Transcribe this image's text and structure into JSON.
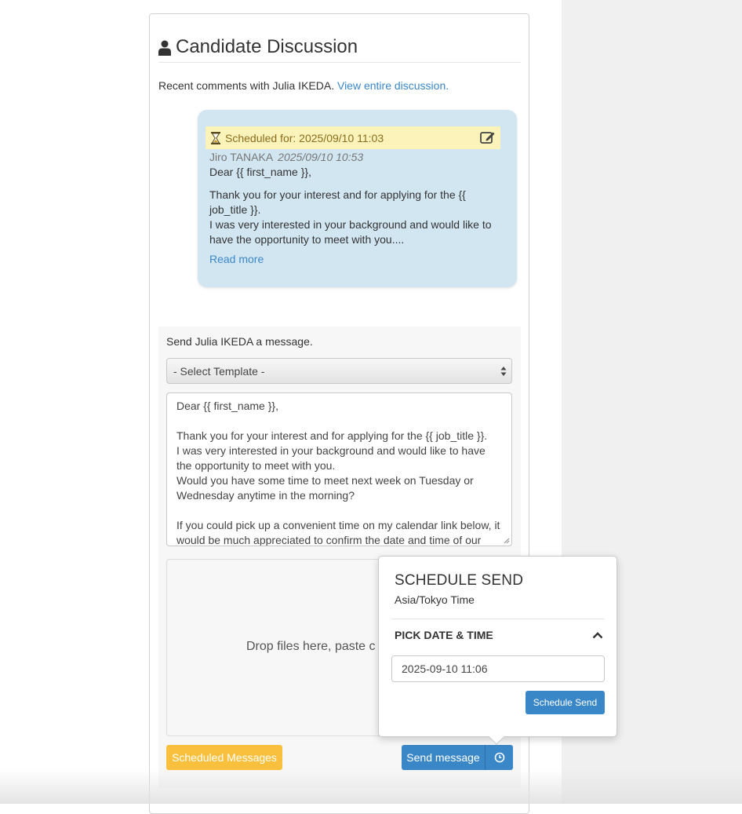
{
  "panel": {
    "title": "Candidate Discussion",
    "recent_prefix": "Recent comments with Julia IKEDA.",
    "view_link": "View entire discussion."
  },
  "comment": {
    "scheduled_label": "Scheduled for: 2025/09/10 11:03",
    "author": "Jiro TANAKA",
    "timestamp": "2025/09/10 10:53",
    "greeting": "Dear {{ first_name }},",
    "line1": "Thank you for your interest and for applying for the {{ job_title }}.",
    "line2": "I was very interested in your background and would like to have the opportunity to meet with you....",
    "read_more": "Read more"
  },
  "compose": {
    "label": "Send Julia IKEDA a message.",
    "template_select": "- Select Template -",
    "body_lines": [
      "Dear {{ first_name }},",
      "",
      "Thank you for your interest and for applying for the {{ job_title }}.",
      "I was very interested in your background and would like to have the opportunity to meet with you.",
      "Would you have some time to meet next week on Tuesday or Wednesday anytime in the morning?",
      "",
      "If you could pick up a convenient time on my calendar link below, it would be much appreciated to confirm the date and time of our"
    ],
    "dropzone_text": "Drop files here, paste c",
    "scheduled_button": "Scheduled Messages",
    "send_button": "Send message"
  },
  "schedule_popover": {
    "title": "SCHEDULE SEND",
    "timezone": "Asia/Tokyo Time",
    "section_label": "PICK DATE & TIME",
    "datetime_value": "2025-09-10 11:06",
    "submit_button": "Schedule Send"
  },
  "colors": {
    "accent": "#3a87c8",
    "warning": "#f8c03c",
    "bubble": "#d2e6f2",
    "scheduled_bar": "#fbf3b9"
  }
}
